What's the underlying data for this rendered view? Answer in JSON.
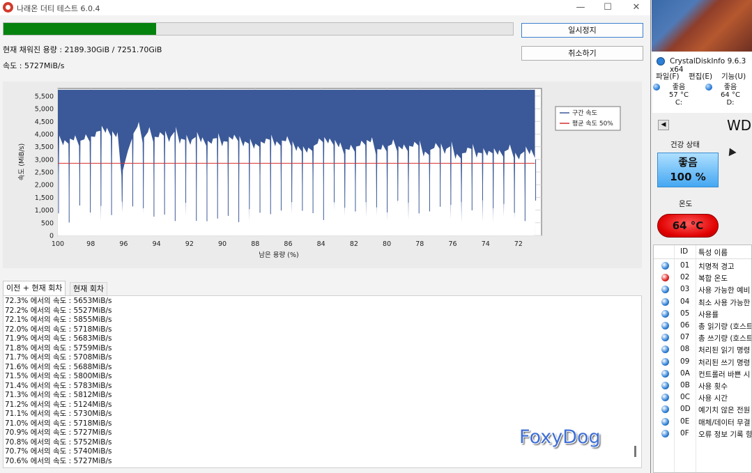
{
  "main_window": {
    "title": "나래온 더티 테스트 6.0.4",
    "window_controls": [
      "—",
      "☐",
      "✕"
    ],
    "progress_fraction": 0.3,
    "pause_label": "일시정지",
    "cancel_label": "취소하기",
    "capacity_text": "현재 채워진 용량 : 2189.30GiB / 7251.70GiB",
    "speed_text": "속도 : 5727MiB/s",
    "tabs": [
      "이전 + 현재 회차",
      "현재 회차"
    ],
    "log_lines": [
      "72.3% 에서의 속도 : 5653MiB/s",
      "72.2% 에서의 속도 : 5527MiB/s",
      "72.1% 에서의 속도 : 5855MiB/s",
      "72.0% 에서의 속도 : 5718MiB/s",
      "71.9% 에서의 속도 : 5683MiB/s",
      "71.8% 에서의 속도 : 5759MiB/s",
      "71.7% 에서의 속도 : 5708MiB/s",
      "71.6% 에서의 속도 : 5688MiB/s",
      "71.5% 에서의 속도 : 5800MiB/s",
      "71.4% 에서의 속도 : 5783MiB/s",
      "71.3% 에서의 속도 : 5812MiB/s",
      "71.2% 에서의 속도 : 5124MiB/s",
      "71.1% 에서의 속도 : 5730MiB/s",
      "71.0% 에서의 속도 : 5718MiB/s",
      "70.9% 에서의 속도 : 5727MiB/s",
      "70.8% 에서의 속도 : 5752MiB/s",
      "70.7% 에서의 속도 : 5740MiB/s",
      "70.6% 에서의 속도 : 5727MiB/s"
    ]
  },
  "chart_data": {
    "type": "area",
    "xlabel": "남은 용량 (%)",
    "ylabel": "속도 (MiB/s)",
    "xlim": [
      100,
      70.6
    ],
    "ylim": [
      0,
      5800
    ],
    "x_ticks": [
      100,
      98,
      96,
      94,
      92,
      90,
      88,
      86,
      84,
      82,
      80,
      78,
      76,
      74,
      72
    ],
    "y_ticks": [
      0,
      500,
      1000,
      1500,
      2000,
      2500,
      3000,
      3500,
      4000,
      4500,
      5000,
      5500
    ],
    "y_tick_labels": [
      "0",
      "500",
      "1,000",
      "1,500",
      "2,000",
      "2,500",
      "3,000",
      "3,500",
      "4,000",
      "4,500",
      "5,000",
      "5,500"
    ],
    "grid": true,
    "legend_position": "top-right",
    "series": [
      {
        "name": "구간 속도",
        "color": "#3b5998",
        "top_value": 5750,
        "valley_levels": [
          3500,
          3800,
          3600,
          3500,
          3400,
          3300,
          3200,
          3200,
          3100,
          3100,
          3000,
          3000
        ],
        "drop_min": 500
      },
      {
        "name": "평균 속도 50%",
        "color": "#d32f2f",
        "value": 2850
      }
    ]
  },
  "crystaldiskinfo": {
    "title": "CrystalDiskInfo 9.6.3 x64",
    "menu": [
      "파일(F)",
      "편집(E)",
      "기능(U)"
    ],
    "drives": [
      {
        "status": "좋음",
        "temp": "57 °C",
        "letter": "C:"
      },
      {
        "status": "좋음",
        "temp": "64 °C",
        "letter": "D:"
      }
    ],
    "model": "WD",
    "health_label": "건강 상태",
    "health_status": "좋음",
    "health_percent": "100 %",
    "temp_label": "온도",
    "temp_value": "64 °C",
    "table_header": {
      "id": "ID",
      "name": "특성 이름"
    },
    "attributes": [
      {
        "id": "01",
        "name": "치명적 경고",
        "status": "good"
      },
      {
        "id": "02",
        "name": "복합 온도",
        "status": "warn"
      },
      {
        "id": "03",
        "name": "사용 가능한 예비",
        "status": "good"
      },
      {
        "id": "04",
        "name": "최소 사용 가능한",
        "status": "good"
      },
      {
        "id": "05",
        "name": "사용률",
        "status": "good"
      },
      {
        "id": "06",
        "name": "총 읽기량 (호스트",
        "status": "good"
      },
      {
        "id": "07",
        "name": "총 쓰기량 (호스트",
        "status": "good"
      },
      {
        "id": "08",
        "name": "처리된 읽기 명령",
        "status": "good"
      },
      {
        "id": "09",
        "name": "처리된 쓰기 명령",
        "status": "good"
      },
      {
        "id": "0A",
        "name": "컨트롤러 바쁜 시",
        "status": "good"
      },
      {
        "id": "0B",
        "name": "사용 횟수",
        "status": "good"
      },
      {
        "id": "0C",
        "name": "사용 시간",
        "status": "good"
      },
      {
        "id": "0D",
        "name": "예기치 않은 전원",
        "status": "good"
      },
      {
        "id": "0E",
        "name": "매체/데이터 무결",
        "status": "good"
      },
      {
        "id": "0F",
        "name": "오류 정보 기록 항",
        "status": "good"
      }
    ],
    "colors": {
      "good": "#2d7fd8",
      "warn": "#e02020"
    }
  },
  "watermark": "FoxyDog"
}
